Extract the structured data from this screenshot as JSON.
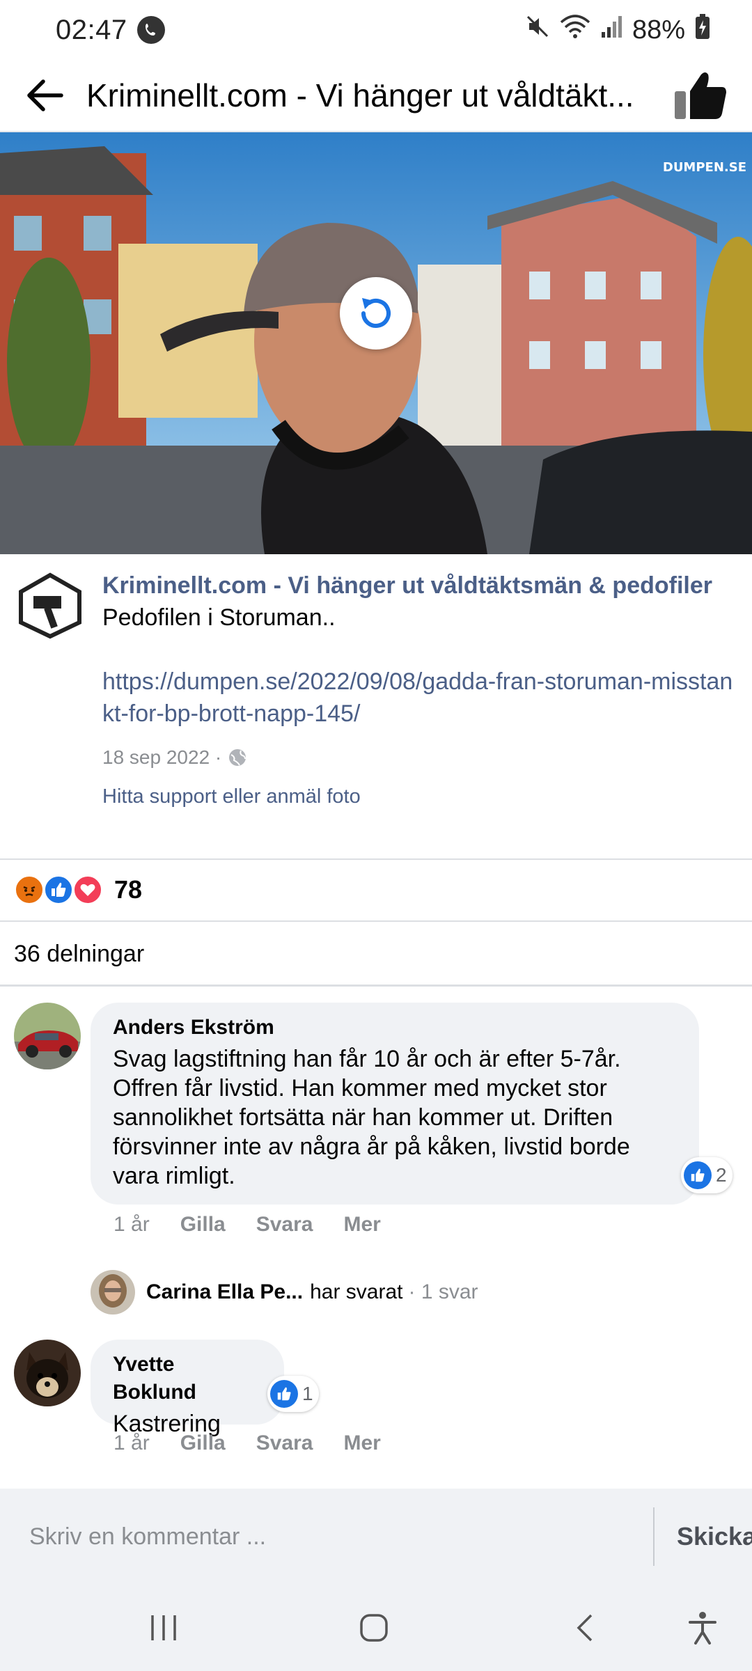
{
  "status_bar": {
    "time": "02:47",
    "battery": "88%"
  },
  "header": {
    "title": "Kriminellt.com - Vi hänger ut våldtäkt..."
  },
  "photo": {
    "watermark": "DUMPEN.SE"
  },
  "post": {
    "page_name": "Kriminellt.com - Vi hänger ut våldtäktsmän & pedofiler",
    "caption": "Pedofilen i Storuman..",
    "link": "https://dumpen.se/2022/09/08/gadda-fran-storuman-misstankt-for-bp-brott-napp-145/",
    "date": "18 sep 2022 ·",
    "report": "Hitta support eller anmäl foto"
  },
  "reactions": {
    "count": "78",
    "types": [
      "angry",
      "like",
      "love"
    ]
  },
  "shares": "36 delningar",
  "comments": [
    {
      "author": "Anders Ekström",
      "text": "Svag lagstiftning han får 10 år och är efter 5-7år. Offren får livstid. Han kommer med mycket stor sannolikhet fortsätta när han kommer ut. Driften försvinner inte av några år på kåken, livstid borde vara rimligt.",
      "likes": "2",
      "time": "1 år",
      "like_label": "Gilla",
      "reply_label": "Svara",
      "more_label": "Mer"
    },
    {
      "author": "Yvette Boklund",
      "text": "Kastrering",
      "likes": "1",
      "time": "1 år",
      "like_label": "Gilla",
      "reply_label": "Svara",
      "more_label": "Mer"
    }
  ],
  "reply_summary": {
    "name": "Carina Ella Pe...",
    "suffix": "har svarat",
    "count": "· 1 svar"
  },
  "composer": {
    "placeholder": "Skriv en kommentar ...",
    "send_label": "Skicka"
  },
  "colors": {
    "link": "#4b5f87",
    "like_blue": "#1b74e4",
    "bubble_bg": "#f0f2f5"
  }
}
